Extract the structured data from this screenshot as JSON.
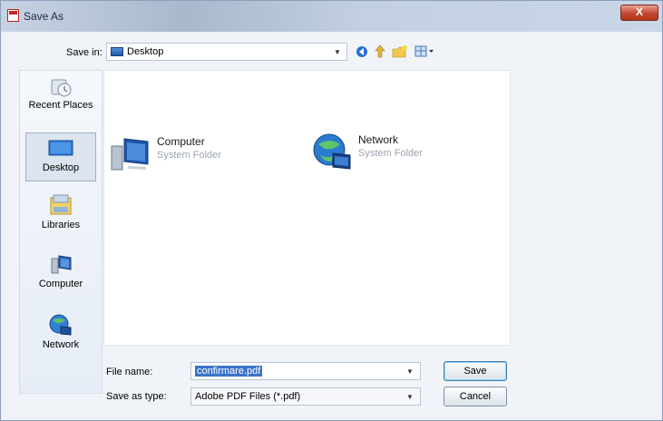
{
  "window": {
    "title": "Save As",
    "close_label": "X"
  },
  "toolbar": {
    "save_in_label": "Save in:",
    "save_in_value": "Desktop",
    "icons": [
      "back-icon",
      "up-folder-icon",
      "new-folder-icon",
      "views-menu-icon"
    ]
  },
  "places": [
    {
      "label": "Recent Places",
      "icon": "recent-places-icon",
      "selected": false
    },
    {
      "label": "Desktop",
      "icon": "desktop-icon",
      "selected": true
    },
    {
      "label": "Libraries",
      "icon": "libraries-icon",
      "selected": false
    },
    {
      "label": "Computer",
      "icon": "computer-icon",
      "selected": false
    },
    {
      "label": "Network",
      "icon": "network-icon",
      "selected": false
    }
  ],
  "files": [
    {
      "name": "Computer",
      "type": "System Folder",
      "icon": "computer-icon"
    },
    {
      "name": "Network",
      "type": "System Folder",
      "icon": "network-icon"
    }
  ],
  "form": {
    "file_name_label": "File name:",
    "file_name_value": "confirmare.pdf",
    "save_as_type_label": "Save as type:",
    "save_as_type_value": "Adobe PDF Files (*.pdf)"
  },
  "buttons": {
    "save": "Save",
    "cancel": "Cancel"
  }
}
